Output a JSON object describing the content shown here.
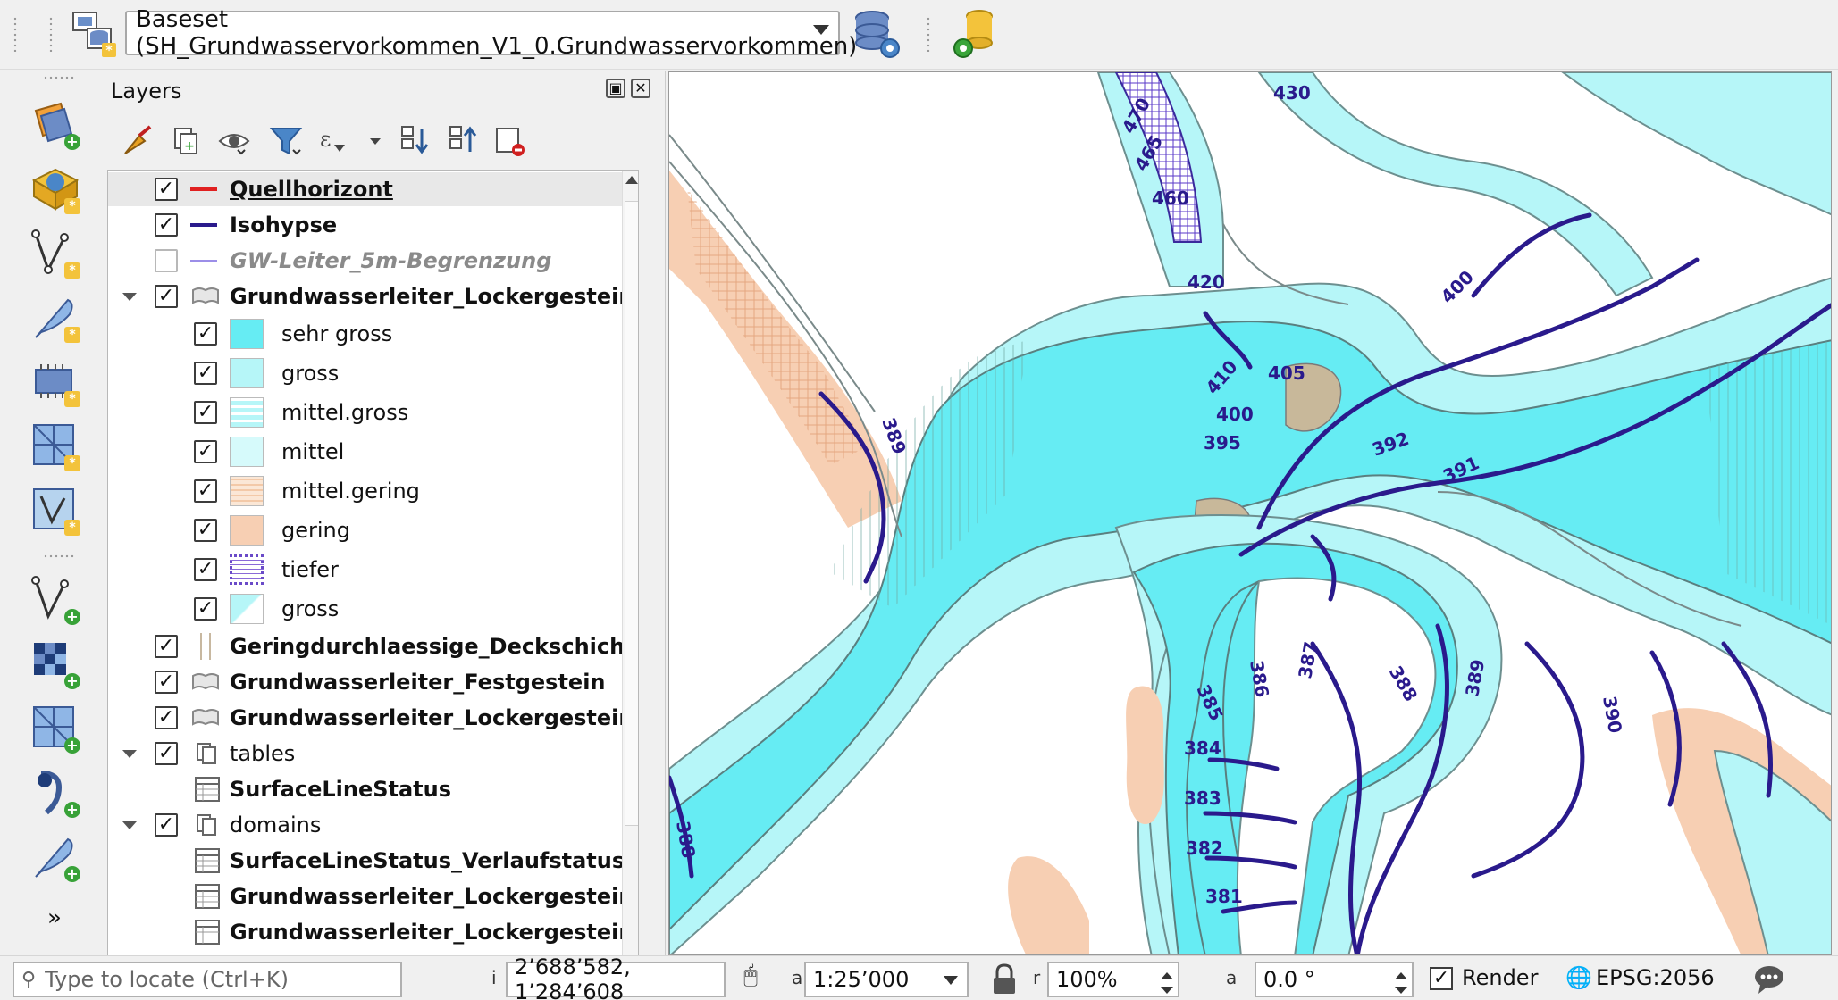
{
  "toolbar": {
    "layer_combo_value": "Baseset (SH_Grundwasservorkommen_V1_0.Grundwasservorkommen)",
    "icons": [
      "layer-config-icon",
      "database-settings-icon",
      "database-import-icon"
    ]
  },
  "iconbar": {
    "tools": [
      "add-layer-icon",
      "add-wms-icon",
      "add-vector-icon",
      "add-feather-icon",
      "add-raster-icon",
      "add-mesh-icon",
      "add-virtual-layer-icon",
      "new-vector-icon",
      "new-raster-icon",
      "new-mesh-icon",
      "new-spatialite-icon",
      "new-temporary-icon",
      "more-chevron-icon"
    ]
  },
  "panel": {
    "title": "Layers",
    "tools": [
      "style-manager-icon",
      "add-group-icon",
      "visibility-icon",
      "filter-legend-icon",
      "expression-filter-icon",
      "expand-all-icon",
      "collapse-all-icon",
      "remove-layer-icon"
    ]
  },
  "tree": [
    {
      "label": "Quellhorizont",
      "checked": true,
      "sym": "line",
      "color": "#e02020"
    },
    {
      "label": "Isohypse",
      "checked": true,
      "sym": "line",
      "color": "#2a1a8c"
    },
    {
      "label": "GW-Leiter_5m-Begrenzung",
      "checked": false,
      "sym": "line",
      "color": "#9c8ee8"
    },
    {
      "label": "Grundwasserleiter_Lockergestein",
      "checked": true,
      "sym": "polygon"
    },
    {
      "label": "sehr gross",
      "checked": true,
      "sym": "fill",
      "color": "#66ecf3"
    },
    {
      "label": "gross",
      "checked": true,
      "sym": "fill",
      "color": "#b6f6f8"
    },
    {
      "label": "mittel.gross",
      "checked": true,
      "sym": "hatch-h",
      "color": "#b6f6f8"
    },
    {
      "label": "mittel",
      "checked": true,
      "sym": "fill",
      "color": "#d6fafb"
    },
    {
      "label": "mittel.gering",
      "checked": true,
      "sym": "hatch-orange",
      "color": "#fbe7d6"
    },
    {
      "label": "gering",
      "checked": true,
      "sym": "fill",
      "color": "#f7cfb3"
    },
    {
      "label": "tiefer",
      "checked": true,
      "sym": "grid-purple",
      "color": "#ffffff"
    },
    {
      "label": "gross",
      "checked": true,
      "sym": "diag",
      "color": "#b6f6f8"
    },
    {
      "label": "Geringdurchlaessige_Deckschicht",
      "checked": true,
      "sym": "vlines"
    },
    {
      "label": "Grundwasserleiter_Festgestein",
      "checked": true,
      "sym": "polygon"
    },
    {
      "label": "Grundwasserleiter_Lockergestein",
      "checked": true,
      "sym": "polygon"
    },
    {
      "label": "tables",
      "checked": true,
      "sym": "group"
    },
    {
      "label": "SurfaceLineStatus",
      "checked": null,
      "sym": "table"
    },
    {
      "label": "domains",
      "checked": true,
      "sym": "group"
    },
    {
      "label": "SurfaceLineStatus_Verlaufstatus",
      "checked": null,
      "sym": "table"
    },
    {
      "label": "Grundwasserleiter_Lockergestein_D",
      "checked": null,
      "sym": "table"
    },
    {
      "label": "Grundwasserleiter_Lockergestein_D",
      "checked": null,
      "sym": "table"
    }
  ],
  "map": {
    "contour_labels": [
      "430",
      "470",
      "465",
      "460",
      "420",
      "400",
      "410",
      "405",
      "400",
      "395",
      "392",
      "391",
      "389",
      "388",
      "386",
      "385",
      "384",
      "383",
      "382",
      "381",
      "387",
      "388",
      "389",
      "390"
    ]
  },
  "status": {
    "locator_placeholder": "Type to locate (Ctrl+K)",
    "coordinate_value": "2’688’582, 1’284’608",
    "scale_value": "1:25’000",
    "magnifier_value": "100%",
    "rotation_value": "0.0 °",
    "render_label": "Render",
    "render_checked": true,
    "crs_label": "EPSG:2056",
    "coord_letter": "i",
    "scale_letter": "a",
    "mag_letter": "r",
    "rot_letter": "a"
  }
}
